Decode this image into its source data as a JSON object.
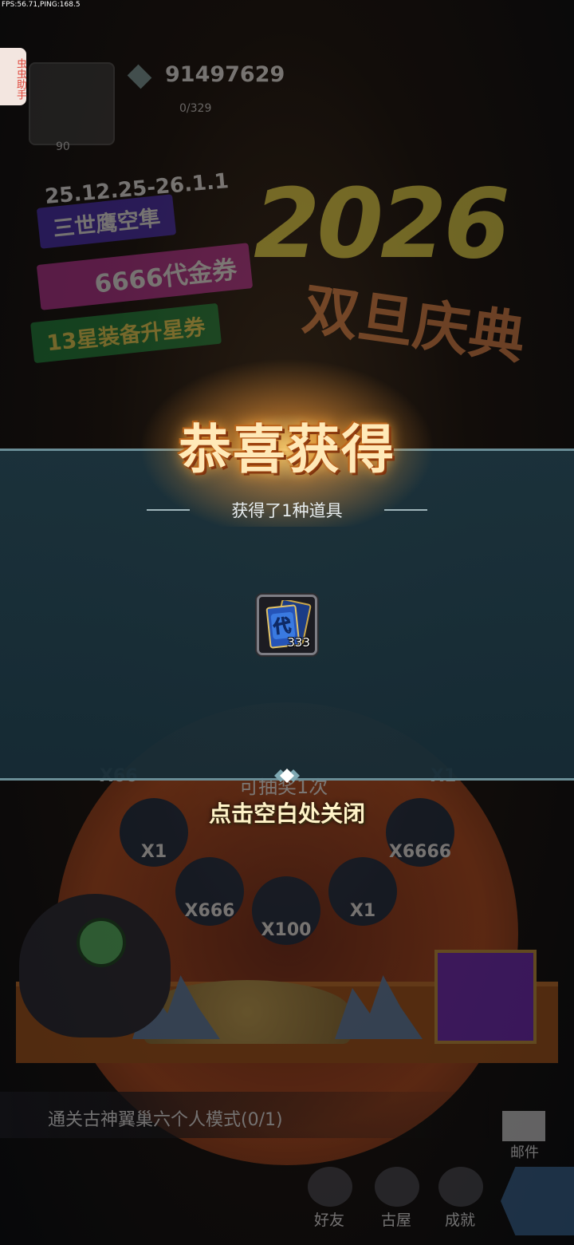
{
  "debug": {
    "fps_ping": "FPS:56.71,PING:168.5"
  },
  "helper": {
    "label": "虫虫助手"
  },
  "player": {
    "level": "90",
    "gems": "91497629",
    "energy": "0/329"
  },
  "event": {
    "date": "25.12.25-26.1.1",
    "banner1": "三世鹰空隼",
    "banner2": "6666代金券",
    "banner3": "13星装备升星券",
    "year": "2026",
    "celebration": "双旦庆典"
  },
  "wheel": {
    "draw_count": "可抽奖1次",
    "slots": [
      "X1",
      "X6666",
      "X666",
      "X100",
      "X1"
    ],
    "top_left": "X66",
    "top_right": "X1"
  },
  "quest": {
    "text": "通关古神翼巢六个人模式(0/1)"
  },
  "nav": {
    "mail": "邮件",
    "friends": "好友",
    "guild": "古屋",
    "achievements": "成就"
  },
  "popup": {
    "title": "恭喜获得",
    "subtitle": "获得了1种道具",
    "item": {
      "icon": "voucher-icon",
      "glyph": "代",
      "count": "333"
    },
    "close_hint": "点击空白处关闭"
  }
}
